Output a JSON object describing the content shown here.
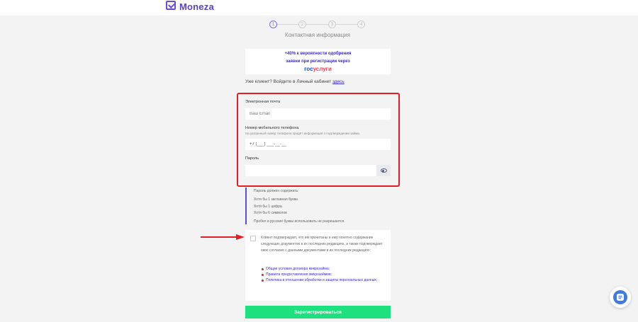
{
  "brand": {
    "name": "Moneza"
  },
  "steps": {
    "items": [
      "1",
      "2",
      "3",
      "4"
    ],
    "active_index": 0,
    "title": "Контактная информация"
  },
  "gosuslugi": {
    "line1": "+40% к вероятности одобрения",
    "line2": "заявки при регистрации через",
    "brand_part1": "гос",
    "brand_part2": "услуги"
  },
  "client": {
    "text": "Уже клиент? Войдите в Личный кабинет",
    "link": "здесь"
  },
  "form": {
    "email_label": "Электронная почта",
    "email_placeholder": "Ваш Email",
    "phone_label": "Номер мобильного телефона",
    "phone_hint": "На указанный номер телефона придёт информация о подтверждении займа.",
    "phone_value": "+7 (___) ___-__-__",
    "password_label": "Пароль",
    "password_value": ""
  },
  "password_rules": {
    "title": "Пароль должен содержать:",
    "rule1": "Хотя бы 1 заглавная буква",
    "rule2": "Хотя бы 1 цифра",
    "rule3": "Хотя бы 6 символов",
    "note": "Пробел и русские буквы использовать не разрешается."
  },
  "consent": {
    "checked": false,
    "text": "Клиент подтверждает, что им прочитаны и ему понятно содержание следующих документов в их последних редакциях, а также подтверждает свое согласие с данными документами в их последних редакциях:",
    "doc1": "Общие условия договора микрозайма;",
    "doc2": "Правила предоставления микрозаймов;",
    "doc3": "Политика в отношении обработки и защиты персональных данных;"
  },
  "submit_label": "Зарегистрироваться",
  "colors": {
    "accent": "#5a3fd1",
    "highlight_border": "#e31e24",
    "submit_bg": "#1fe07e",
    "chat_bg": "#3d7be0"
  },
  "icons": {
    "logo": "check-square-icon",
    "password_toggle": "eye-icon",
    "chat": "chat-icon",
    "annotation": "red-arrow-icon"
  }
}
